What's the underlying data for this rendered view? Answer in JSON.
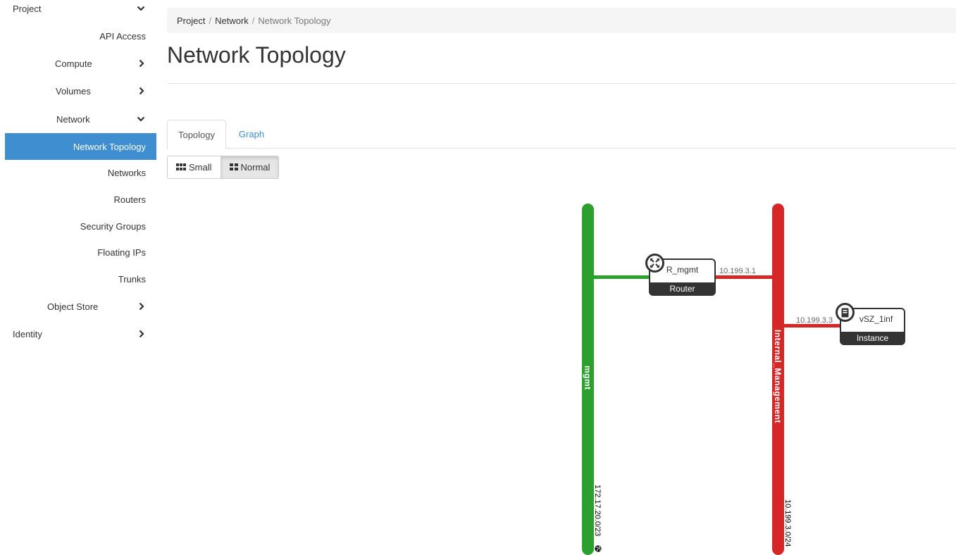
{
  "sidebar": {
    "project": "Project",
    "api_access": "API Access",
    "compute": "Compute",
    "volumes": "Volumes",
    "network": "Network",
    "network_topology": "Network Topology",
    "networks": "Networks",
    "routers": "Routers",
    "security_groups": "Security Groups",
    "floating_ips": "Floating IPs",
    "trunks": "Trunks",
    "object_store": "Object Store",
    "identity": "Identity",
    "active_color": "#3e8ed0"
  },
  "breadcrumb": {
    "project": "Project",
    "network": "Network",
    "current": "Network Topology",
    "separator": "/"
  },
  "page_title": "Network Topology",
  "tabs": {
    "topology": "Topology",
    "graph": "Graph"
  },
  "view_toggle": {
    "small": "Small",
    "normal": "Normal",
    "selected": "Normal"
  },
  "topology": {
    "networks": [
      {
        "name": "mgmt",
        "cidr": "172.17.20.0/23",
        "color": "#2ca02c",
        "external": true
      },
      {
        "name": "Internal_Management",
        "cidr": "10.199.3.0/24",
        "color": "#d62728"
      }
    ],
    "router": {
      "name": "R_mgmt",
      "type": "Router",
      "ip": "10.199.3.1"
    },
    "instance": {
      "name": "vSZ_1inf",
      "type": "Instance",
      "ip": "10.199.3.3"
    }
  }
}
